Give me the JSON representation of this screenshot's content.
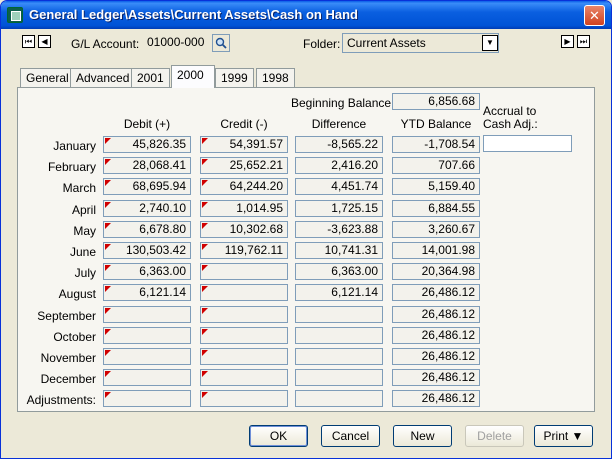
{
  "window": {
    "title": "General Ledger\\Assets\\Current Assets\\Cash on Hand",
    "close_label": "✕"
  },
  "nav": {
    "first": "⏮",
    "prev": "◀",
    "next": "▶",
    "last": "⏭"
  },
  "header": {
    "account_label": "G/L Account:",
    "account_value": "01000-000",
    "folder_label": "Folder:",
    "folder_value": "Current Assets",
    "folder_arrow": "▼"
  },
  "tabs": [
    {
      "label": "General"
    },
    {
      "label": "Advanced"
    },
    {
      "label": "2001"
    },
    {
      "label": "2000"
    },
    {
      "label": "1999"
    },
    {
      "label": "1998"
    }
  ],
  "active_tab": "2000",
  "panel": {
    "beginning_balance_label": "Beginning Balance:",
    "beginning_balance_value": "6,856.68",
    "accrual_label_1": "Accrual to",
    "accrual_label_2": "Cash Adj.:",
    "accrual_value": "",
    "columns": {
      "debit": "Debit (+)",
      "credit": "Credit (-)",
      "difference": "Difference",
      "ytd": "YTD Balance"
    },
    "rows": [
      {
        "month": "January",
        "debit": "45,826.35",
        "credit": "54,391.57",
        "difference": "-8,565.22",
        "ytd": "-1,708.54"
      },
      {
        "month": "February",
        "debit": "28,068.41",
        "credit": "25,652.21",
        "difference": "2,416.20",
        "ytd": "707.66"
      },
      {
        "month": "March",
        "debit": "68,695.94",
        "credit": "64,244.20",
        "difference": "4,451.74",
        "ytd": "5,159.40"
      },
      {
        "month": "April",
        "debit": "2,740.10",
        "credit": "1,014.95",
        "difference": "1,725.15",
        "ytd": "6,884.55"
      },
      {
        "month": "May",
        "debit": "6,678.80",
        "credit": "10,302.68",
        "difference": "-3,623.88",
        "ytd": "3,260.67"
      },
      {
        "month": "June",
        "debit": "130,503.42",
        "credit": "119,762.11",
        "difference": "10,741.31",
        "ytd": "14,001.98"
      },
      {
        "month": "July",
        "debit": "6,363.00",
        "credit": "",
        "difference": "6,363.00",
        "ytd": "20,364.98"
      },
      {
        "month": "August",
        "debit": "6,121.14",
        "credit": "",
        "difference": "6,121.14",
        "ytd": "26,486.12"
      },
      {
        "month": "September",
        "debit": "",
        "credit": "",
        "difference": "",
        "ytd": "26,486.12"
      },
      {
        "month": "October",
        "debit": "",
        "credit": "",
        "difference": "",
        "ytd": "26,486.12"
      },
      {
        "month": "November",
        "debit": "",
        "credit": "",
        "difference": "",
        "ytd": "26,486.12"
      },
      {
        "month": "December",
        "debit": "",
        "credit": "",
        "difference": "",
        "ytd": "26,486.12"
      },
      {
        "month": "Adjustments:",
        "debit": "",
        "credit": "",
        "difference": "",
        "ytd": "26,486.12"
      }
    ]
  },
  "buttons": {
    "ok": "OK",
    "cancel": "Cancel",
    "new": "New",
    "delete": "Delete",
    "print": "Print ▼"
  },
  "colors": {
    "titlebar": "#0053d6",
    "flag": "#d00000",
    "window_bg": "#ece9d8"
  }
}
